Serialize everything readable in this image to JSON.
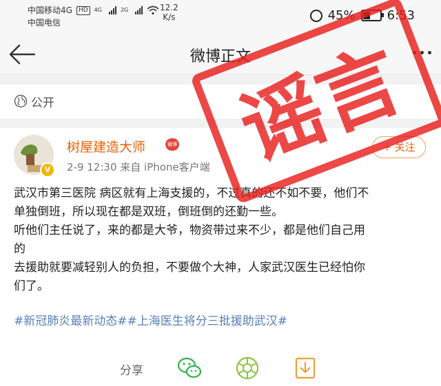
{
  "status_bar": {
    "carrier_1": "中国移动4G",
    "hd_badge": "HD",
    "carrier_2": "中国电信",
    "signal_1": "4G",
    "signal_2": "2G",
    "speed_value": "12.2",
    "speed_unit": "K/s",
    "battery": "45%",
    "time": "6:53"
  },
  "nav": {
    "title": "微博正文"
  },
  "visibility": "公开",
  "post": {
    "author": "树屋建造大师",
    "author_badge": "微博",
    "meta": "2-9 12:30  来自 iPhone客户端",
    "follow_label": "+ 关注",
    "lines": [
      "武汉市第三医院 病区就有上海支援的，不过真的还不如不要，他们不",
      "单独倒班，所以现在都是双班，倒班倒的还勤一些。",
      "听他们主任说了，来的都是大爷，物资带过来不少，都是他们自己用",
      "的",
      "去援助就要减轻别人的负担，不要做个大神，人家武汉医生已经怕你",
      "们了。"
    ],
    "hashtags": "#新冠肺炎最新动态##上海医生将分三批援助武汉#"
  },
  "actions": {
    "share_label": "分享"
  },
  "stamp": {
    "text": "谣言",
    "color": "#e8201e"
  },
  "icons": [
    "back-arrow-icon",
    "more-icon",
    "globe-icon",
    "wechat-icon",
    "moments-icon",
    "save-icon",
    "alarm-icon",
    "wifi-icon"
  ]
}
